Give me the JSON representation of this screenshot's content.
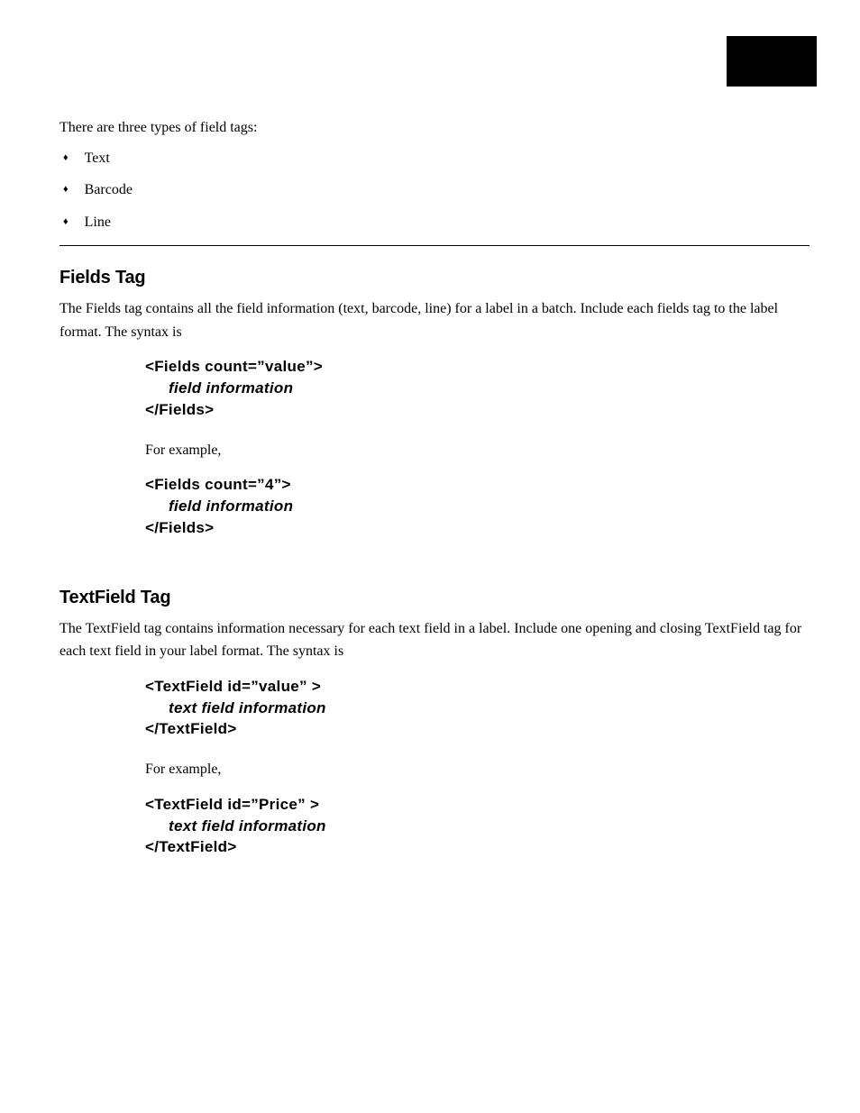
{
  "intro": "There are three types of field tags:",
  "bullets": [
    "Text",
    "Barcode",
    "Line"
  ],
  "sections": {
    "fields": {
      "heading": "Fields Tag",
      "description": "The Fields tag contains all the field information (text, barcode, line) for a label in a batch. Include each fields tag to the label format. The syntax is",
      "syntax": [
        "<Fields count=”value”>",
        "field information",
        "</Fields>"
      ],
      "exampleLabel": "For example,",
      "example": [
        "<Fields count=”4”>",
        "field information",
        "</Fields>"
      ]
    },
    "textfield": {
      "heading": "TextField Tag",
      "description": "The TextField tag contains information necessary for each text field in a label. Include one opening and closing TextField tag for each text field in your label format. The syntax is",
      "syntax": [
        "<TextField id=”value” >",
        "text field information",
        "</TextField>"
      ],
      "exampleLabel": "For example,",
      "example": [
        "<TextField id=”Price” >",
        "text field information",
        "</TextField>"
      ]
    }
  }
}
